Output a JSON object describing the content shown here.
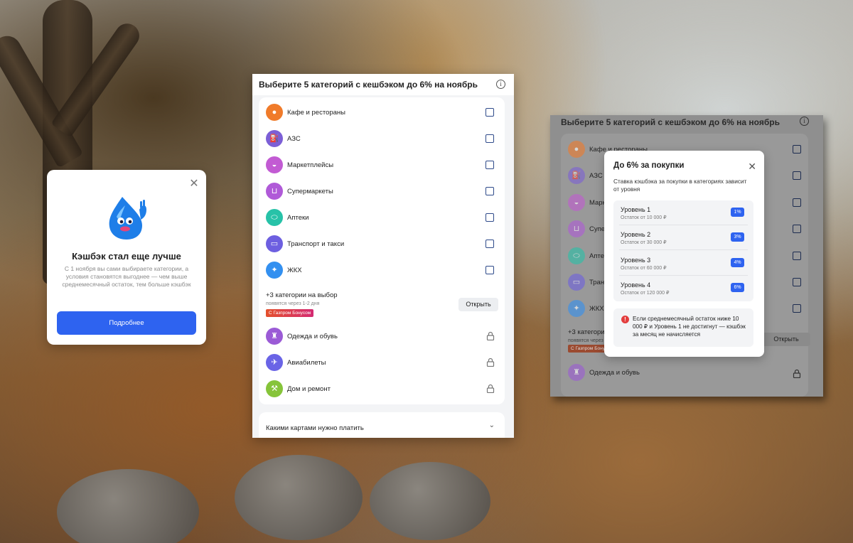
{
  "promo": {
    "title": "Кэшбэк стал еще лучше",
    "text": "С 1 ноября вы сами выбираете категории, а условия становятся выгоднее — чем выше среднемесячный остаток, тем больше кэшбэк",
    "button": "Подробнее",
    "close_icon": "✕"
  },
  "panel": {
    "title": "Выберите 5 категорий с кешбэком до 6% на ноябрь",
    "info_icon": "i",
    "categories": [
      {
        "label": "Кафе и рестораны",
        "icon": "cafe-icon",
        "color": "#f07b2a"
      },
      {
        "label": "АЗС",
        "icon": "gas-station-icon",
        "color": "#7c5fd6"
      },
      {
        "label": "Маркетплейсы",
        "icon": "basket-icon",
        "color": "#c25bd3"
      },
      {
        "label": "Супермаркеты",
        "icon": "cart-icon",
        "color": "#b05ad8"
      },
      {
        "label": "Аптеки",
        "icon": "pills-icon",
        "color": "#27c2a8"
      },
      {
        "label": "Транспорт и такси",
        "icon": "bus-icon",
        "color": "#6d5fe0"
      },
      {
        "label": "ЖКХ",
        "icon": "utilities-icon",
        "color": "#3390f0"
      }
    ],
    "extra": {
      "title": "+3 категории на выбор",
      "subtitle": "появятся через 1-2 дня",
      "badge": "С Газпром Бонусом",
      "button": "Открыть"
    },
    "locked": [
      {
        "label": "Одежда и обувь",
        "icon": "clothes-icon",
        "color": "#9b5bd6"
      },
      {
        "label": "Авиабилеты",
        "icon": "plane-icon",
        "color": "#6a64e6"
      },
      {
        "label": "Дом и ремонт",
        "icon": "hammer-icon",
        "color": "#86c43a"
      }
    ],
    "cards_question": "Какими картами нужно платить",
    "chevron": "⌄"
  },
  "rpanel": {
    "title": "Выберите 5 категорий с кешбэком до 6% на ноябрь",
    "info_icon": "i",
    "categories": [
      {
        "label": "Кафе и рестораны"
      },
      {
        "label": "АЗС"
      },
      {
        "label": "Марк"
      },
      {
        "label": "Супе"
      },
      {
        "label": "Апте"
      },
      {
        "label": "Тран"
      },
      {
        "label": "ЖКХ"
      }
    ],
    "extra": {
      "title": "+3 категори",
      "subtitle": "появятся через",
      "badge": "С Газпром Бону",
      "button": "Открыть"
    },
    "locked_first": "Одежда и обувь"
  },
  "modal": {
    "title": "До 6% за покупки",
    "description": "Ставка кэшбэка за покупки в категориях зависит от уровня",
    "levels": [
      {
        "name": "Уровень 1",
        "rest": "Остаток от 10 000 ₽",
        "pct": "1%"
      },
      {
        "name": "Уровень 2",
        "rest": "Остаток от 30 000 ₽",
        "pct": "3%"
      },
      {
        "name": "Уровень 3",
        "rest": "Остаток от 60 000 ₽",
        "pct": "4%"
      },
      {
        "name": "Уровень 4",
        "rest": "Остаток от 120 000 ₽",
        "pct": "6%"
      }
    ],
    "warning": "Если среднемесячный остаток ниже 10 000 ₽ и Уровень 1 не достигнут — кэшбэк за месяц не начисляется",
    "warning_icon": "!",
    "close_icon": "✕"
  },
  "colors": {
    "accent": "#2e63f0",
    "badge_gradient": [
      "#e4502c",
      "#d42a72"
    ],
    "warning": "#e33d3d"
  }
}
